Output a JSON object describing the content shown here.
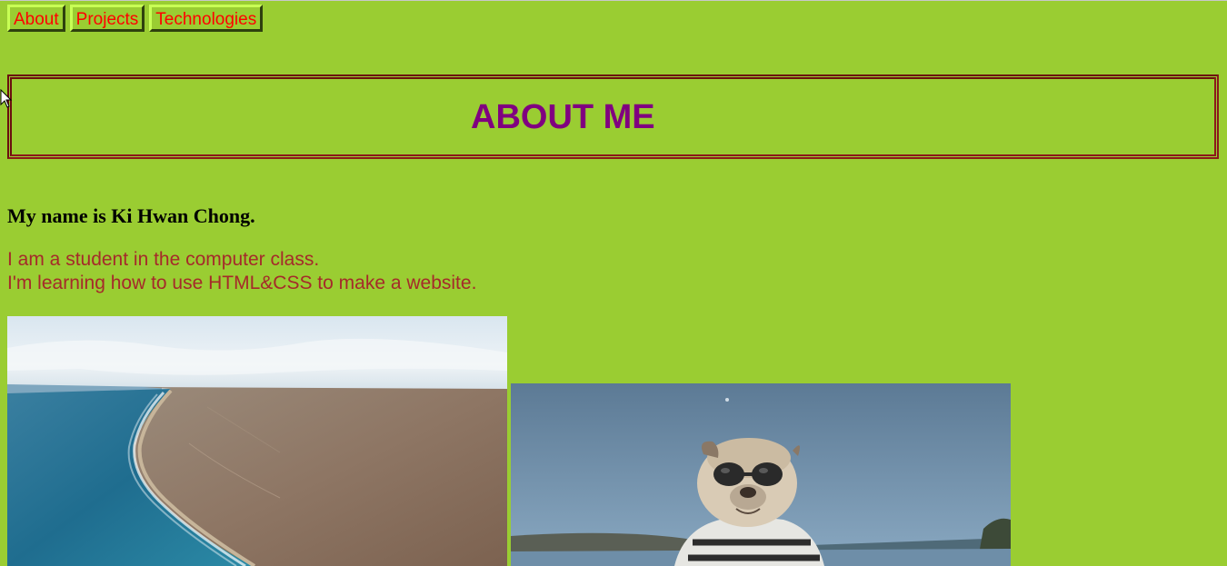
{
  "nav": {
    "items": [
      {
        "label": "About"
      },
      {
        "label": "Projects"
      },
      {
        "label": "Technologies"
      }
    ]
  },
  "header": {
    "title": "ABOUT ME"
  },
  "content": {
    "name_line": "My name is Ki Hwan Chong.",
    "intro_line_1": "I am a student in the computer class.",
    "intro_line_2": "I'm learning how to use HTML&CSS to make a website."
  },
  "images": {
    "first": "coastline-cliff-photo",
    "second": "dog-in-sunglasses-photo"
  },
  "colors": {
    "page_background": "#9acd32",
    "nav_text": "#ff0000",
    "title_text": "#800080",
    "title_border": "#8b1a1a",
    "intro_text": "#a52a2a"
  }
}
